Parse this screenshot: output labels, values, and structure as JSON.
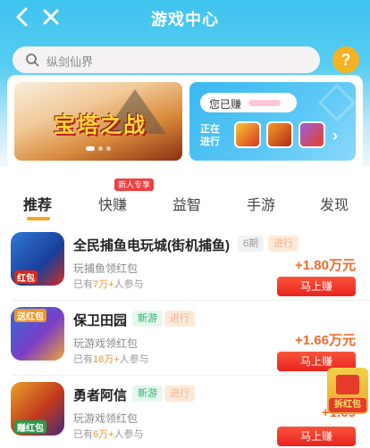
{
  "nav": {
    "title": "游戏中心"
  },
  "search": {
    "placeholder": "纵剑仙界",
    "help": "?"
  },
  "banner": {
    "logo": "宝塔之战"
  },
  "earn": {
    "prefix": "您已赚",
    "running": "正在进行"
  },
  "tabs": [
    {
      "label": "推荐"
    },
    {
      "label": "快赚"
    },
    {
      "label": "益智"
    },
    {
      "label": "手游"
    },
    {
      "label": "发现"
    }
  ],
  "tab_badge": "新人专享",
  "games": [
    {
      "name": "全民捕鱼电玩城(街机捕鱼)",
      "tag": "6期",
      "tag2": "进行",
      "sub": "玩捕鱼领红包",
      "ppl_prefix": "已有",
      "ppl_num": "7万+",
      "ppl_suffix": "人参与",
      "amount": "+1.80万元",
      "button": "马上赚",
      "thumb_badge": "红包"
    },
    {
      "name": "保卫田园",
      "tag": "新游",
      "tag2": "进行",
      "sub": "玩游戏领红包",
      "ppl_prefix": "已有",
      "ppl_num": "18万+",
      "ppl_suffix": "人参与",
      "amount": "+1.66万元",
      "button": "马上赚",
      "thumb_badge": "送红包"
    },
    {
      "name": "勇者阿信",
      "tag": "新游",
      "tag2": "进行",
      "sub": "玩游戏领红包",
      "ppl_prefix": "已有",
      "ppl_num": "6万+",
      "ppl_suffix": "人参与",
      "amount": "+1.69",
      "button": "马上赚",
      "thumb_badge": "赚红包"
    }
  ],
  "floater": {
    "label": "拆红包"
  },
  "colors": {
    "header": "#3ec3ee",
    "accent": "#f6a62a",
    "button": "#e8231e",
    "amount": "#f06a2c"
  }
}
